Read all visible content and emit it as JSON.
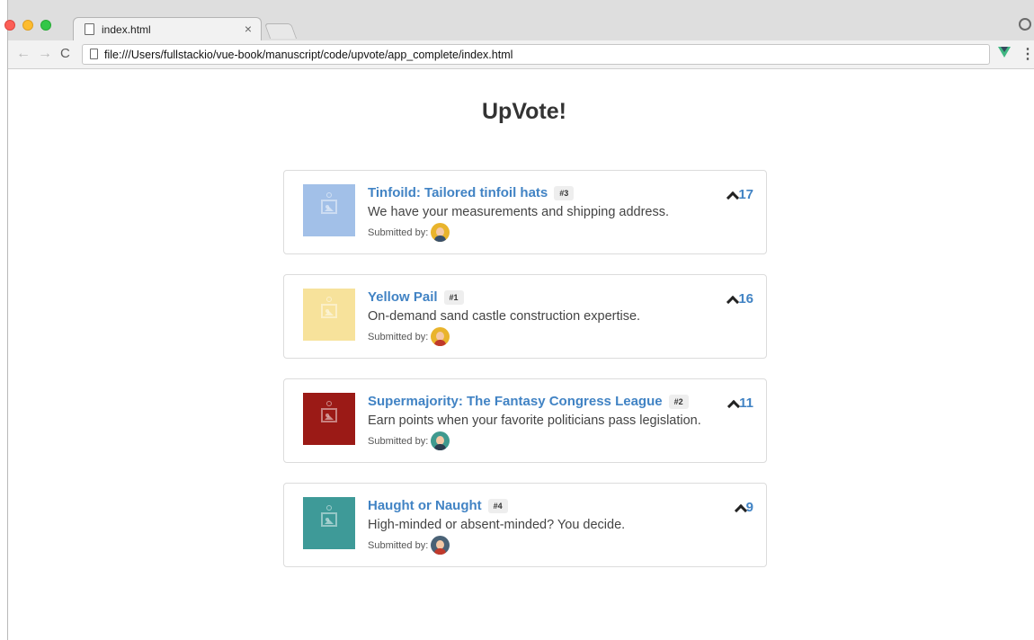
{
  "browser": {
    "tab_title": "index.html",
    "tab_close": "×",
    "url": "file:///Users/fullstackio/vue-book/manuscript/code/upvote/app_complete/index.html",
    "nav_back": "←",
    "nav_forward": "→",
    "reload": "C",
    "menu": "⋮"
  },
  "page": {
    "title": "UpVote!"
  },
  "submitted_by_label": "Submitted by:",
  "submissions": [
    {
      "title": "Tinfoild: Tailored tinfoil hats",
      "rank": "#3",
      "description": "We have your measurements and shipping address.",
      "votes": "17",
      "thumb_color": "#a2c0e8",
      "avatar_bg": "#e9b42c",
      "avatar_body": "#39506a"
    },
    {
      "title": "Yellow Pail",
      "rank": "#1",
      "description": "On-demand sand castle construction expertise.",
      "votes": "16",
      "thumb_color": "#f7e29b",
      "avatar_bg": "#e9b42c",
      "avatar_body": "#c0392b"
    },
    {
      "title": "Supermajority: The Fantasy Congress League",
      "rank": "#2",
      "description": "Earn points when your favorite politicians pass legislation.",
      "votes": "11",
      "thumb_color": "#9b1a16",
      "avatar_bg": "#3f9a8f",
      "avatar_body": "#2c3e50"
    },
    {
      "title": "Haught or Naught",
      "rank": "#4",
      "description": "High-minded or absent-minded? You decide.",
      "votes": "9",
      "thumb_color": "#3e9a98",
      "avatar_bg": "#4a6276",
      "avatar_body": "#c0392b"
    }
  ]
}
